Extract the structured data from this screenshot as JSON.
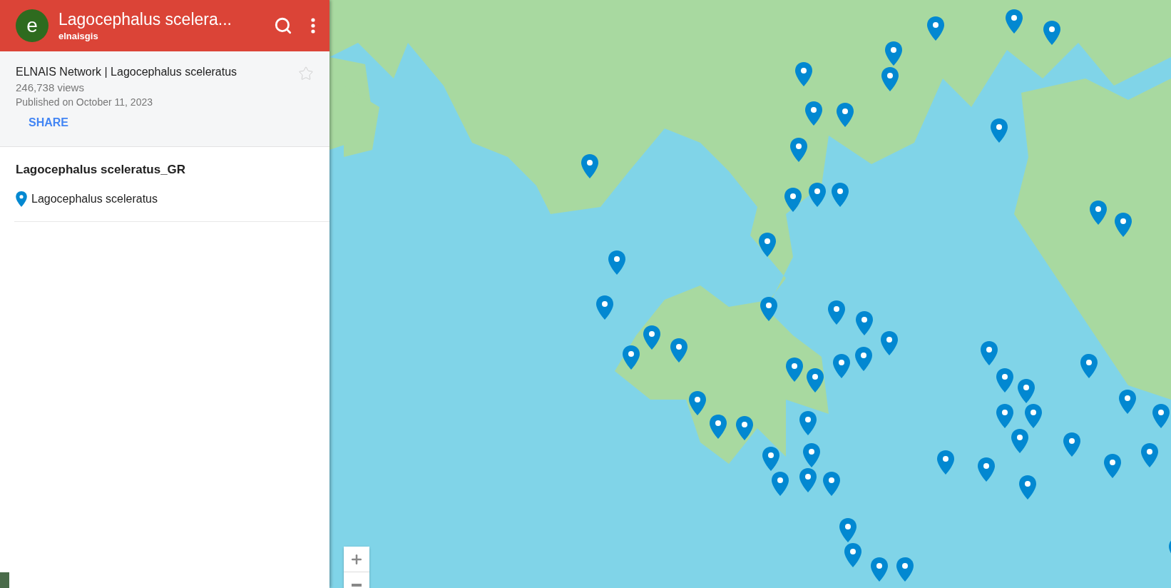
{
  "header": {
    "avatar_letter": "e",
    "title": "Lagocephalus scelera...",
    "owner": "elnaisgis"
  },
  "info": {
    "title": "ELNAIS Network | Lagocephalus sceleratus",
    "views": "246,738 views",
    "published": "Published on October 11, 2023",
    "share": "SHARE"
  },
  "layers": [
    {
      "name": "Lagocephalus sceleratus_GR",
      "items": [
        {
          "label": "Lagocephalus sceleratus",
          "color": "#0288d1"
        }
      ]
    }
  ]
}
